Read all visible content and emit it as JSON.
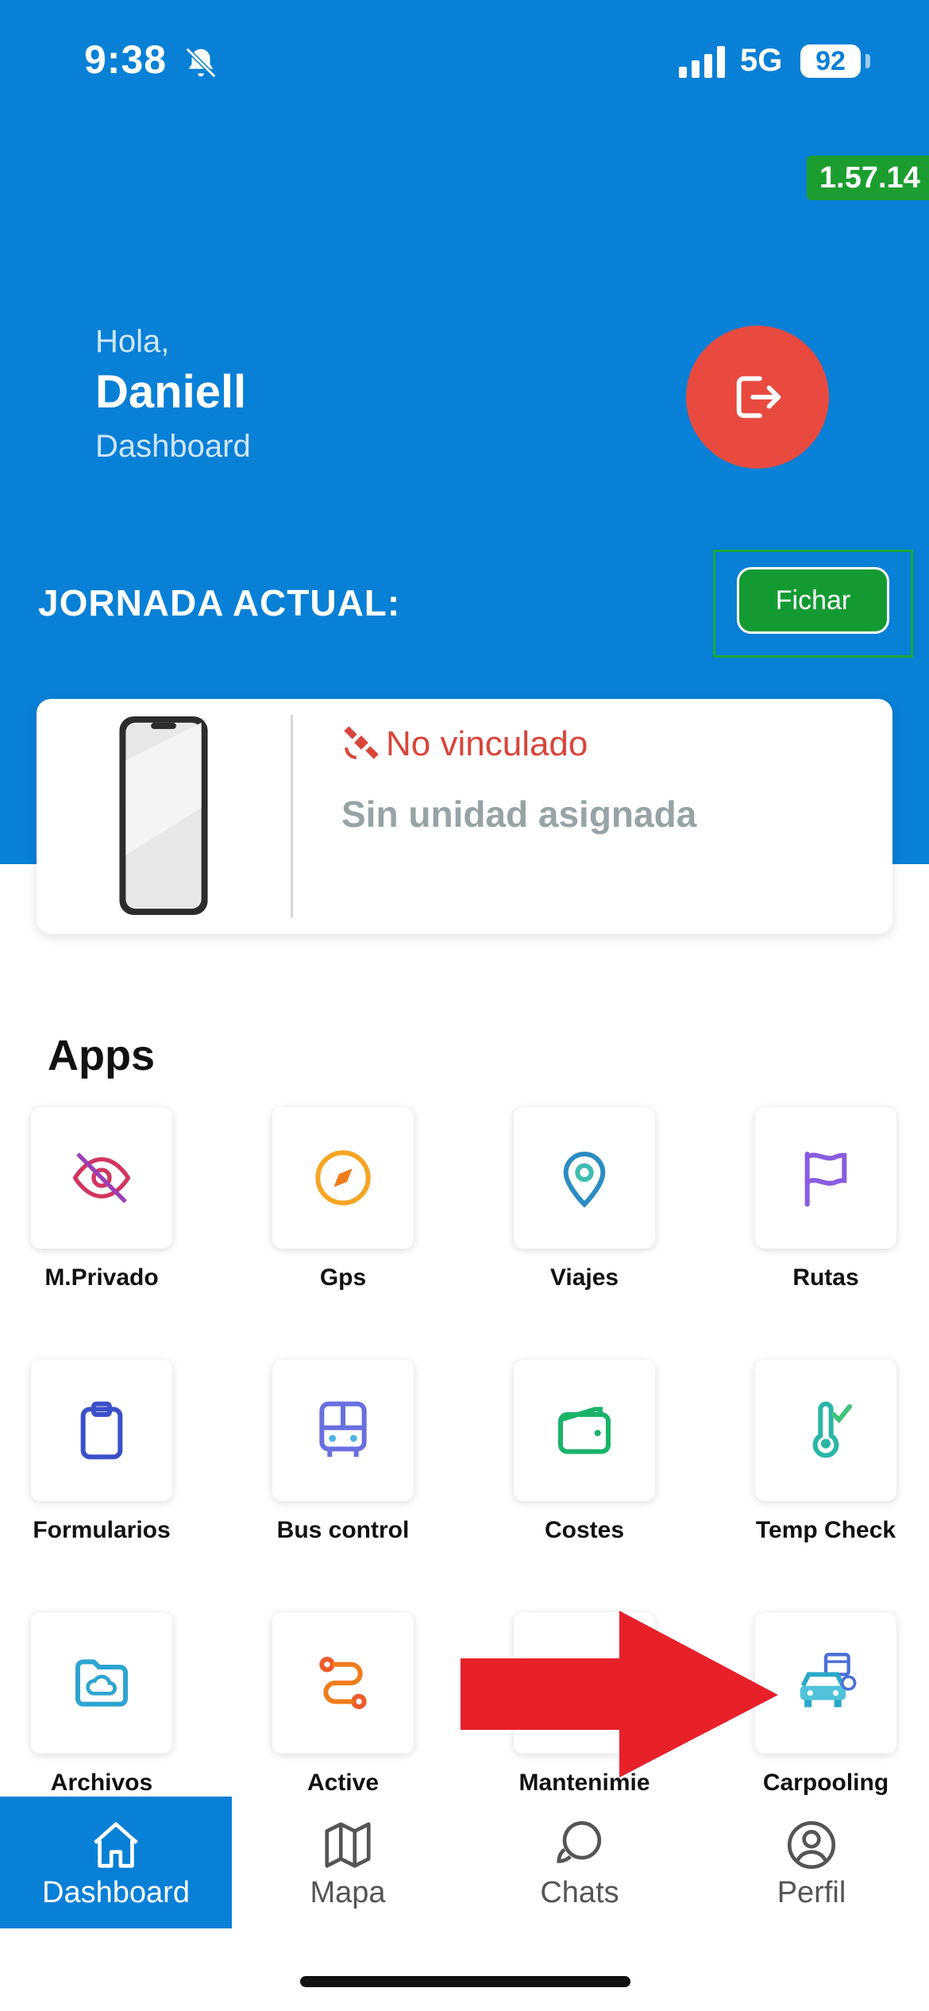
{
  "status_bar": {
    "time": "9:38",
    "network": "5G",
    "battery": "92"
  },
  "version": "1.57.14",
  "header": {
    "greeting": "Hola,",
    "user_name": "Daniell",
    "subtitle": "Dashboard"
  },
  "jornada": {
    "label": "JORNADA ACTUAL:",
    "button": "Fichar"
  },
  "unit_card": {
    "status": "No vinculado",
    "unit": "Sin unidad asignada"
  },
  "apps": {
    "title": "Apps",
    "items": [
      {
        "label": "M.Privado",
        "icon": "eye-off-icon"
      },
      {
        "label": "Gps",
        "icon": "compass-icon"
      },
      {
        "label": "Viajes",
        "icon": "map-pin-icon"
      },
      {
        "label": "Rutas",
        "icon": "flag-icon"
      },
      {
        "label": "Formularios",
        "icon": "clipboard-icon"
      },
      {
        "label": "Bus control",
        "icon": "bus-icon"
      },
      {
        "label": "Costes",
        "icon": "wallet-icon"
      },
      {
        "label": "Temp Check",
        "icon": "thermometer-icon"
      },
      {
        "label": "Archivos",
        "icon": "folder-cloud-icon"
      },
      {
        "label": "Active",
        "icon": "route-icon"
      },
      {
        "label": "Mantenimie",
        "icon": "wrench-icon"
      },
      {
        "label": "Carpooling",
        "icon": "car-calendar-icon"
      }
    ]
  },
  "bottom_nav": [
    {
      "label": "Dashboard",
      "icon": "home-icon",
      "active": true
    },
    {
      "label": "Mapa",
      "icon": "map-icon",
      "active": false
    },
    {
      "label": "Chats",
      "icon": "chat-icon",
      "active": false
    },
    {
      "label": "Perfil",
      "icon": "profile-icon",
      "active": false
    }
  ],
  "colors": {
    "primary": "#0880d6",
    "logout": "#e84a3f",
    "fichar": "#149a33",
    "annotation_arrow": "#e8202a"
  }
}
